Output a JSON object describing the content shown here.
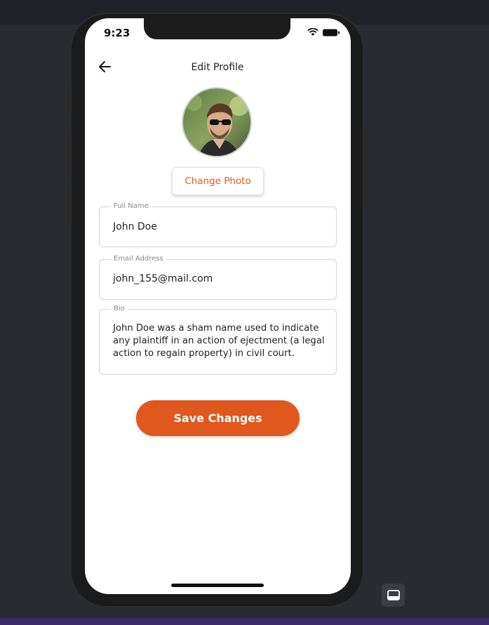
{
  "status_bar": {
    "time": "9:23"
  },
  "header": {
    "title": "Edit Profile"
  },
  "profile": {
    "change_photo_label": "Change Photo"
  },
  "form": {
    "full_name": {
      "label": "Full Name",
      "value": "John Doe"
    },
    "email": {
      "label": "Email Address",
      "value": "john_155@mail.com"
    },
    "bio": {
      "label": "Bio",
      "value": "John Doe was a sham name used to indicate any plaintiff in an action of ejectment (a legal action to regain property) in civil court."
    }
  },
  "actions": {
    "save_label": "Save Changes"
  },
  "colors": {
    "accent": "#e0581e",
    "background": "#282c30"
  },
  "icons": [
    "back-arrow-icon",
    "wifi-icon",
    "battery-icon",
    "panel-icon"
  ]
}
